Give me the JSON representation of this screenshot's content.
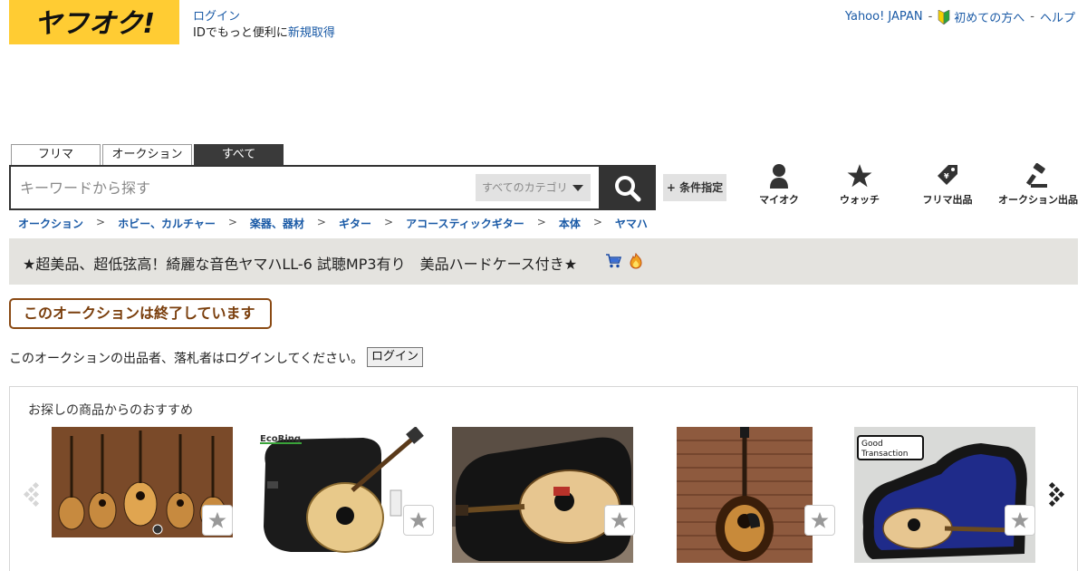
{
  "header": {
    "logo_text": "ヤフオク!",
    "login_link": "ログイン",
    "login_sub": "IDでもっと便利に",
    "register_link": "新規取得",
    "top_links": [
      "Yahoo! JAPAN",
      "初めての方へ",
      "ヘルプ"
    ],
    "separator": "-"
  },
  "search": {
    "tabs": [
      {
        "label": "フリマ",
        "active": false
      },
      {
        "label": "オークション",
        "active": false
      },
      {
        "label": "すべて",
        "active": true
      }
    ],
    "placeholder": "キーワードから探す",
    "category": "すべてのカテゴリ",
    "condition_button": "+ 条件指定"
  },
  "quick_icons": [
    {
      "label": "マイオク",
      "icon": "person-icon"
    },
    {
      "label": "ウォッチ",
      "icon": "star-icon"
    },
    {
      "label": "フリマ出品",
      "icon": "price-tag-icon"
    },
    {
      "label": "オークション出品",
      "icon": "gavel-icon"
    }
  ],
  "breadcrumb": {
    "items": [
      "オークション",
      "ホビー、カルチャー",
      "楽器、器材",
      "ギター",
      "アコースティックギター",
      "本体",
      "ヤマハ"
    ],
    "arrow": ">"
  },
  "item": {
    "title": "★超美品、超低弦高！綺麗な音色ヤマハLL-6 試聴MP3有り　美品ハードケース付き★",
    "ended_message": "このオークションは終了しています",
    "login_note": "このオークションの出品者、落札者はログインしてください。",
    "login_button": "ログイン"
  },
  "recommend": {
    "heading": "お探しの商品からのおすすめ",
    "items": [
      {
        "name": "guitar-wall-display"
      },
      {
        "name": "guitar-with-gig-bag",
        "badge": "EcoRing"
      },
      {
        "name": "guitar-in-black-case"
      },
      {
        "name": "sunburst-guitar-brick-wall"
      },
      {
        "name": "guitar-in-blue-case",
        "badge": "Good Transaction"
      }
    ]
  },
  "colors": {
    "brand_yellow": "#ffcc33",
    "link_blue": "#1a5aa6",
    "title_bar": "#e4e3df",
    "ended_brown": "#7a3e0c"
  }
}
